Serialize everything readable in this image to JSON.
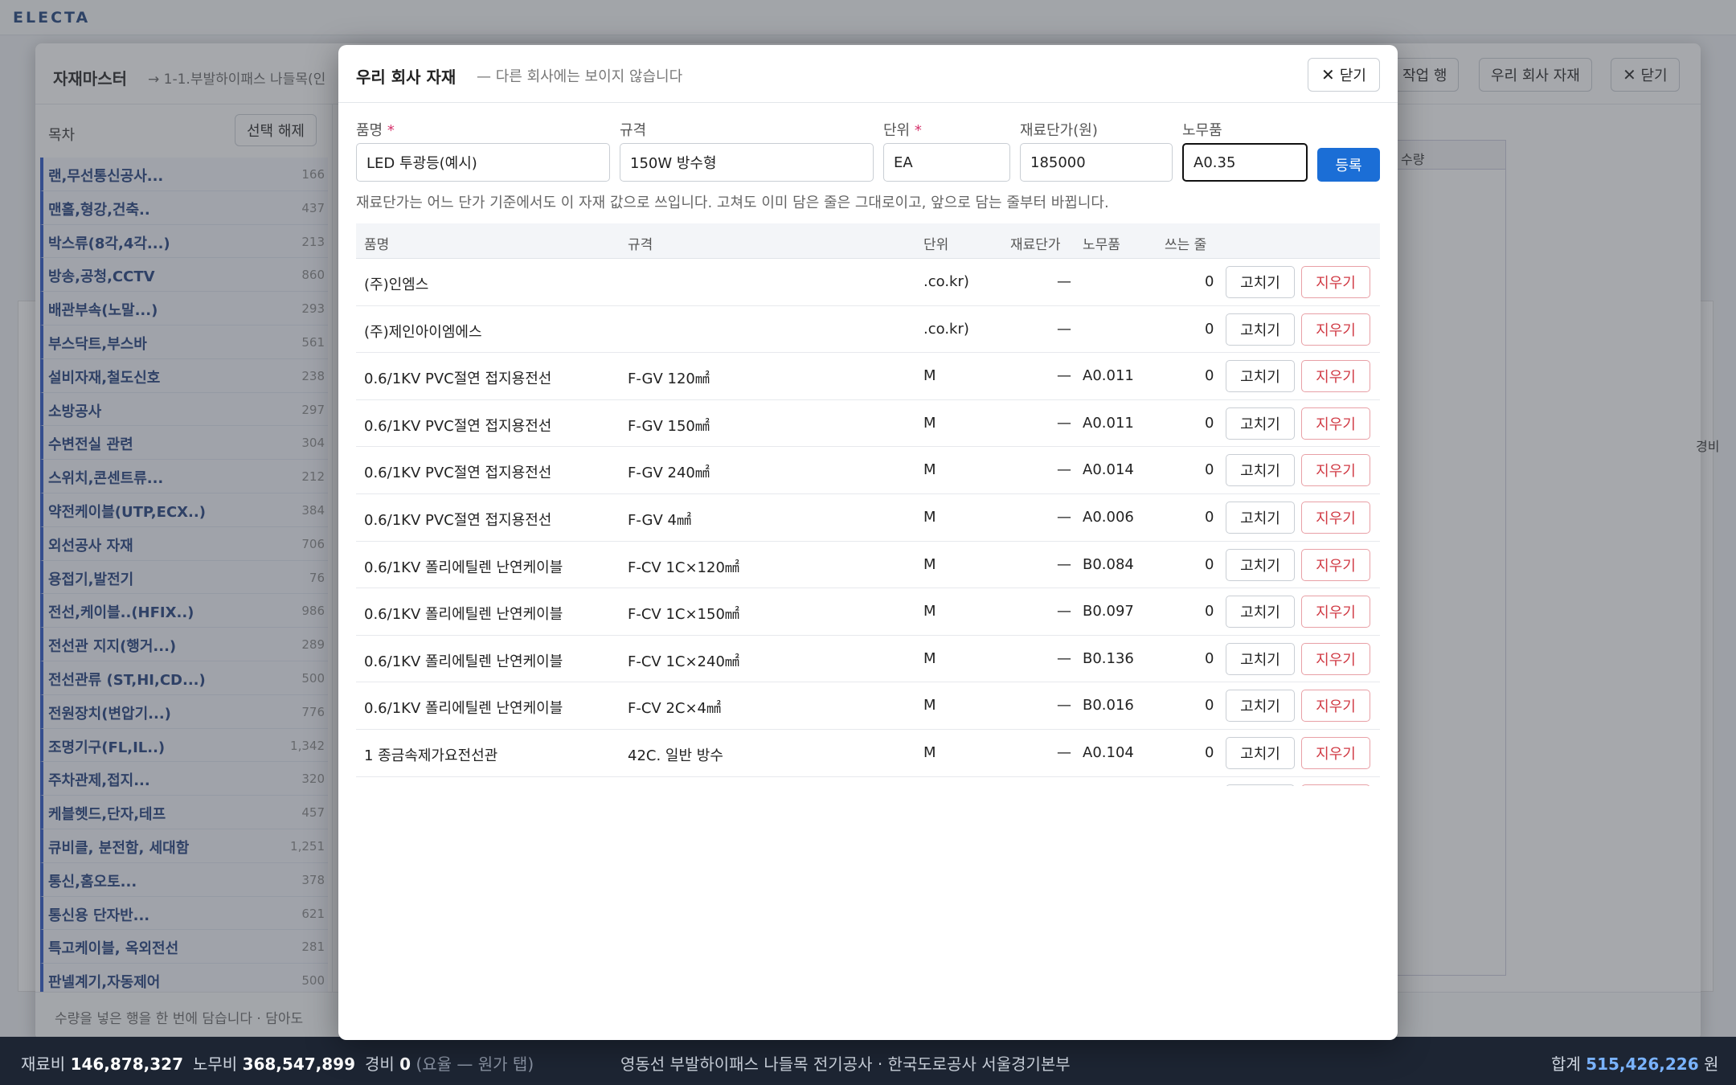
{
  "app": {
    "brand": "ELECTA"
  },
  "master": {
    "title": "자재마스터",
    "path": "→ 1-1.부발하이패스 나들목(인",
    "buttons": {
      "work_row": "작업 행",
      "our_company": "우리 회사 자재",
      "close": "닫기"
    },
    "toc_label": "목차",
    "clear_selection": "선택 해제",
    "grid_qty_header": "수량",
    "footer_text": "수량을 넣은 행을 한 번에 담습니다 · 담아도",
    "side_header": "경비"
  },
  "toc": [
    {
      "name": "랜,무선통신공사...",
      "count": "166"
    },
    {
      "name": "맨홀,형강,건축..",
      "count": "437"
    },
    {
      "name": "박스류(8각,4각...)",
      "count": "213"
    },
    {
      "name": "방송,공청,CCTV",
      "count": "860"
    },
    {
      "name": "배관부속(노말...)",
      "count": "293"
    },
    {
      "name": "부스닥트,부스바",
      "count": "561"
    },
    {
      "name": "설비자재,철도신호",
      "count": "238"
    },
    {
      "name": "소방공사",
      "count": "297"
    },
    {
      "name": "수변전실 관련",
      "count": "304"
    },
    {
      "name": "스위치,콘센트류...",
      "count": "212"
    },
    {
      "name": "약전케이블(UTP,ECX..)",
      "count": "384"
    },
    {
      "name": "외선공사 자재",
      "count": "706"
    },
    {
      "name": "용접기,발전기",
      "count": "76"
    },
    {
      "name": "전선,케이블..(HFIX..)",
      "count": "986"
    },
    {
      "name": "전선관 지지(행거...)",
      "count": "289"
    },
    {
      "name": "전선관류 (ST,HI,CD...)",
      "count": "500"
    },
    {
      "name": "전원장치(변압기...)",
      "count": "776"
    },
    {
      "name": "조명기구(FL,IL..)",
      "count": "1,342"
    },
    {
      "name": "주차관제,접지...",
      "count": "320"
    },
    {
      "name": "케블헷드,단자,테프",
      "count": "457"
    },
    {
      "name": "큐비클, 분전함, 세대함",
      "count": "1,251"
    },
    {
      "name": "통신,홈오토...",
      "count": "378"
    },
    {
      "name": "통신용 단자반...",
      "count": "621"
    },
    {
      "name": "특고케이블, 옥외전선",
      "count": "281"
    },
    {
      "name": "판넬계기,자동제어",
      "count": "500"
    }
  ],
  "modal": {
    "title": "우리 회사 자재",
    "subtitle": "— 다른 회사에는 보이지 않습니다",
    "close_label": "닫기",
    "form": {
      "name_label": "품명",
      "spec_label": "규격",
      "unit_label": "단위",
      "price_label": "재료단가(원)",
      "labor_label": "노무품",
      "required_mark": "*",
      "name_value": "LED 투광등(예시)",
      "spec_value": "150W 방수형",
      "unit_value": "EA",
      "price_value": "185000",
      "labor_value": "A0.35",
      "register_label": "등록"
    },
    "note": "재료단가는 어느 단가 기준에서도 이 자재 값으로 쓰입니다. 고쳐도 이미 담은 줄은 그대로이고, 앞으로 담는 줄부터 바뀝니다.",
    "columns": [
      "품명",
      "규격",
      "단위",
      "재료단가",
      "노무품",
      "쓰는 줄"
    ],
    "edit_label": "고치기",
    "delete_label": "지우기",
    "rows": [
      {
        "name": "(주)인엠스",
        "spec": "",
        "unit": ".co.kr)",
        "price": "—",
        "labor": "",
        "used": "0"
      },
      {
        "name": "(주)제인아이엠에스",
        "spec": "",
        "unit": ".co.kr)",
        "price": "—",
        "labor": "",
        "used": "0"
      },
      {
        "name": "0.6/1KV PVC절연 접지용전선",
        "spec": "F-GV 120㎟",
        "unit": "M",
        "price": "—",
        "labor": "A0.011",
        "used": "0"
      },
      {
        "name": "0.6/1KV PVC절연 접지용전선",
        "spec": "F-GV 150㎟",
        "unit": "M",
        "price": "—",
        "labor": "A0.011",
        "used": "0"
      },
      {
        "name": "0.6/1KV PVC절연 접지용전선",
        "spec": "F-GV 240㎟",
        "unit": "M",
        "price": "—",
        "labor": "A0.014",
        "used": "0"
      },
      {
        "name": "0.6/1KV PVC절연 접지용전선",
        "spec": "F-GV 4㎟",
        "unit": "M",
        "price": "—",
        "labor": "A0.006",
        "used": "0"
      },
      {
        "name": "0.6/1KV 폴리에틸렌 난연케이블",
        "spec": "F-CV 1C×120㎟",
        "unit": "M",
        "price": "—",
        "labor": "B0.084",
        "used": "0"
      },
      {
        "name": "0.6/1KV 폴리에틸렌 난연케이블",
        "spec": "F-CV 1C×150㎟",
        "unit": "M",
        "price": "—",
        "labor": "B0.097",
        "used": "0"
      },
      {
        "name": "0.6/1KV 폴리에틸렌 난연케이블",
        "spec": "F-CV 1C×240㎟",
        "unit": "M",
        "price": "—",
        "labor": "B0.136",
        "used": "0"
      },
      {
        "name": "0.6/1KV 폴리에틸렌 난연케이블",
        "spec": "F-CV 2C×4㎟",
        "unit": "M",
        "price": "—",
        "labor": "B0.016",
        "used": "0"
      },
      {
        "name": "1 종금속제가요전선관",
        "spec": "42C. 일반 방수",
        "unit": "M",
        "price": "—",
        "labor": "A0.104",
        "used": "0"
      }
    ]
  },
  "statusbar": {
    "material_label": "재료비",
    "material_value": "146,878,327",
    "labor_label": "노무비",
    "labor_value": "368,547,899",
    "expense_label": "경비",
    "expense_value": "0",
    "expense_note": "(요율 — 원가 탭)",
    "project": "영동선 부발하이패스 나들목 전기공사 · 한국도로공사 서울경기본부",
    "total_label": "합계",
    "total_value": "515,426,226",
    "currency": "원"
  },
  "icons": {
    "close": "close-icon"
  },
  "colors": {
    "primary": "#1b6ed6",
    "danger": "#d03a44",
    "toc_accent": "#2754c5",
    "status_bg": "#1d2533"
  }
}
